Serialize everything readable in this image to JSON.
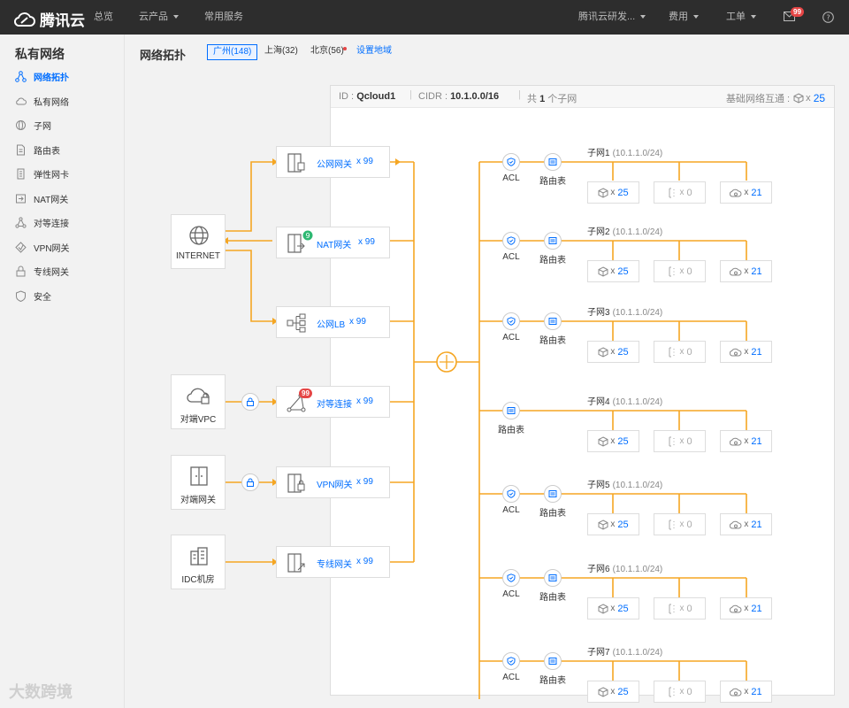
{
  "topbar": {
    "logo_text": "腾讯云",
    "nav_overview": "总览",
    "nav_products": "云产品",
    "nav_common": "常用服务",
    "account": "腾讯云研发...",
    "billing": "费用",
    "ticket": "工单",
    "msg_badge": "99"
  },
  "sidebar": {
    "title": "私有网络",
    "items": [
      {
        "label": "网络拓扑"
      },
      {
        "label": "私有网络"
      },
      {
        "label": "子网"
      },
      {
        "label": "路由表"
      },
      {
        "label": "弹性网卡"
      },
      {
        "label": "NAT网关"
      },
      {
        "label": "对等连接"
      },
      {
        "label": "VPN网关"
      },
      {
        "label": "专线网关"
      },
      {
        "label": "安全"
      }
    ]
  },
  "header": {
    "title": "网络拓扑",
    "regions": [
      {
        "label": "广州(148)"
      },
      {
        "label": "上海(32)"
      },
      {
        "label": "北京(56)"
      }
    ],
    "set_region": "设置地域"
  },
  "panel": {
    "id_label": "ID :",
    "id_value": "Qcloud1",
    "cidr_label": "CIDR :",
    "cidr_value": "10.1.0.0/16",
    "total_prefix": "共",
    "total_count": "1",
    "total_suffix": "个子网",
    "basic_label": "基础网络互通 :",
    "basic_x": "x",
    "basic_count": "25"
  },
  "externals": [
    {
      "label": "INTERNET"
    },
    {
      "label": "对端VPC"
    },
    {
      "label": "对端网关"
    },
    {
      "label": "IDC机房"
    }
  ],
  "gateways": [
    {
      "label": "公网网关",
      "count": "x 99"
    },
    {
      "label": "NAT网关",
      "count": "x 99"
    },
    {
      "label": "公网LB",
      "count": "x 99"
    },
    {
      "label": "对等连接",
      "count": "x 99",
      "badge": "99"
    },
    {
      "label": "VPN网关",
      "count": "x 99"
    },
    {
      "label": "专线网关",
      "count": "x 99"
    }
  ],
  "acl_label": "ACL",
  "route_label": "路由表",
  "subnets": [
    {
      "name": "子网1",
      "cidr": "(10.1.1.0/24)",
      "cvm": "25",
      "ip": "0",
      "db": "21"
    },
    {
      "name": "子网2",
      "cidr": "(10.1.1.0/24)",
      "cvm": "25",
      "ip": "0",
      "db": "21"
    },
    {
      "name": "子网3",
      "cidr": "(10.1.1.0/24)",
      "cvm": "25",
      "ip": "0",
      "db": "21"
    },
    {
      "name": "子网4",
      "cidr": "(10.1.1.0/24)",
      "cvm": "25",
      "ip": "0",
      "db": "21"
    },
    {
      "name": "子网5",
      "cidr": "(10.1.1.0/24)",
      "cvm": "25",
      "ip": "0",
      "db": "21"
    },
    {
      "name": "子网6",
      "cidr": "(10.1.1.0/24)",
      "cvm": "25",
      "ip": "0",
      "db": "21"
    },
    {
      "name": "子网7",
      "cidr": "(10.1.1.0/24)",
      "cvm": "25",
      "ip": "0",
      "db": "21"
    }
  ],
  "res_x": "x",
  "watermark": "大数跨境",
  "colors": {
    "accent": "#006eff",
    "line": "#f5a623",
    "topbar": "#2d2d2d",
    "badge": "#e54545"
  }
}
